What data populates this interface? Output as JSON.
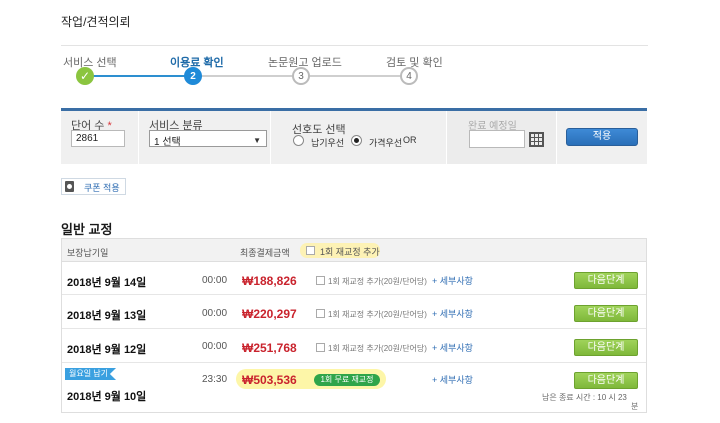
{
  "page": {
    "title": "작업/견적의뢰"
  },
  "steps": [
    {
      "label": "서비스 선택",
      "number": "✓",
      "state": "done"
    },
    {
      "label": "이용료 확인",
      "number": "2",
      "state": "active"
    },
    {
      "label": "논문원고 업로드",
      "number": "3",
      "state": "todo"
    },
    {
      "label": "검토 및 확인",
      "number": "4",
      "state": "todo"
    }
  ],
  "form": {
    "word_count": {
      "label": "단어 수",
      "required": "*",
      "value": "2861"
    },
    "category": {
      "label": "서비스 분류",
      "value": "1 선택"
    },
    "priority": {
      "label": "선호도 선택",
      "option1": "납기우선",
      "option2": "가격우선",
      "suffix": "OR",
      "selected": "option2"
    },
    "deadline": {
      "label": "완료 예정일",
      "value": ""
    },
    "apply_label": "적용"
  },
  "coupon": {
    "label": "쿠폰 적용"
  },
  "section": {
    "title": "일반 교정"
  },
  "table": {
    "headers": {
      "delivery": "보장납기일",
      "price": "최종결제금액",
      "reproof": "1회 재교정 추가"
    },
    "rows": [
      {
        "date": "2018년 9월 14일",
        "time": "00:00",
        "price": "₩188,826",
        "option": "1회 재교정 추가(20원/단어당)",
        "detail": "+ 세부사항",
        "next": "다음단계"
      },
      {
        "date": "2018년 9월 13일",
        "time": "00:00",
        "price": "₩220,297",
        "option": "1회 재교정 추가(20원/단어당)",
        "detail": "+ 세부사항",
        "next": "다음단계"
      },
      {
        "date": "2018년 9월 12일",
        "time": "00:00",
        "price": "₩251,768",
        "option": "1회 재교정 추가(20원/단어당)",
        "detail": "+ 세부사항",
        "next": "다음단계"
      }
    ],
    "urgent": {
      "tag": "월요일 납기",
      "date": "2018년 9월 10일",
      "time": "23:30",
      "price": "₩503,536",
      "badge": "1회 무료 재교정",
      "detail": "+ 세부사항",
      "next": "다음단계",
      "remaining": "남은 종료 시간 : 10 시 23",
      "remaining_unit": "분"
    }
  },
  "colors": {
    "accent": "#2d8fd0",
    "price": "#c9232d",
    "next_button": "#8bc53f",
    "highlight": "#fdf6a8"
  }
}
